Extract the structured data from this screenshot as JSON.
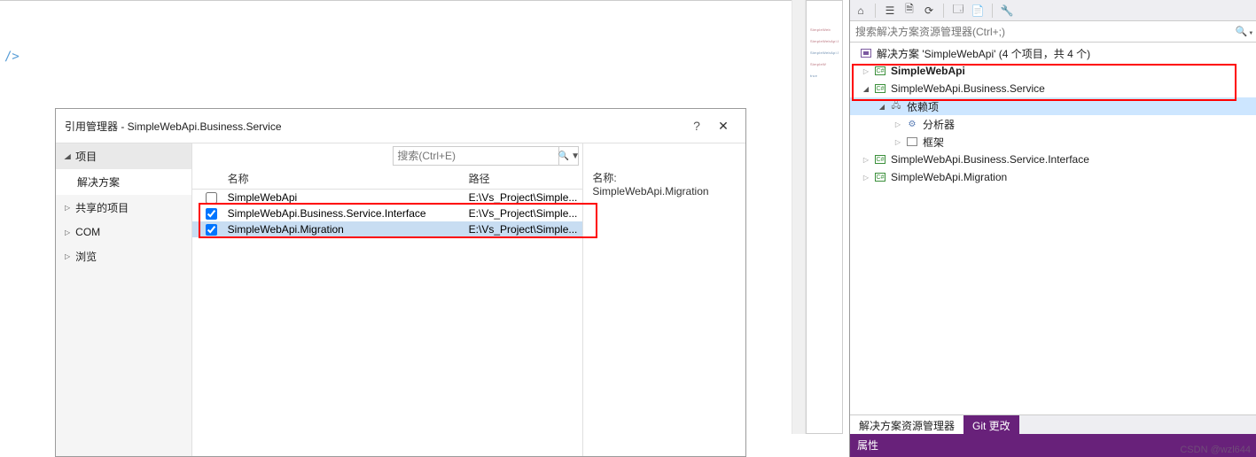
{
  "editor": {
    "angle_text": "/>"
  },
  "dialog": {
    "title": "引用管理器 - SimpleWebApi.Business.Service",
    "help": "?",
    "close": "✕",
    "nav_header": "项目",
    "nav_items": [
      "解决方案",
      "共享的项目",
      "COM",
      "浏览"
    ],
    "search_placeholder": "搜索(Ctrl+E)",
    "col_name": "名称",
    "col_path": "路径",
    "rows": [
      {
        "checked": false,
        "name": "SimpleWebApi",
        "path": "E:\\Vs_Project\\Simple..."
      },
      {
        "checked": true,
        "name": "SimpleWebApi.Business.Service.Interface",
        "path": "E:\\Vs_Project\\Simple..."
      },
      {
        "checked": true,
        "name": "SimpleWebApi.Migration",
        "path": "E:\\Vs_Project\\Simple..."
      }
    ],
    "detail_label": "名称:",
    "detail_value": "SimpleWebApi.Migration"
  },
  "solution": {
    "search_placeholder": "搜索解决方案资源管理器(Ctrl+;)",
    "root": "解决方案 'SimpleWebApi' (4 个项目，共 4 个)",
    "nodes": {
      "p1": "SimpleWebApi",
      "p2": "SimpleWebApi.Business.Service",
      "p2_dep": "依赖项",
      "p2_analyzer": "分析器",
      "p2_frame": "框架",
      "p3": "SimpleWebApi.Business.Service.Interface",
      "p4": "SimpleWebApi.Migration"
    },
    "tabs": {
      "active": "解决方案资源管理器",
      "git": "Git 更改"
    }
  },
  "props": {
    "title": "属性"
  },
  "watermark": "CSDN @wzl644"
}
